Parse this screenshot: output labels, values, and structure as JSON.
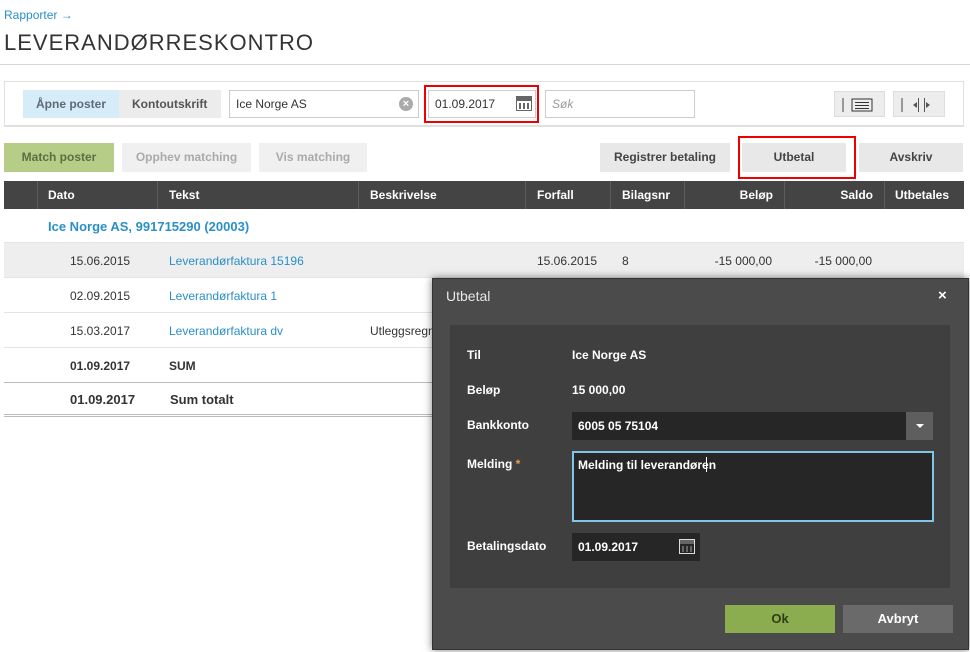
{
  "breadcrumb": "Rapporter →",
  "page_title": "LEVERANDØRRESKONTRO",
  "toolbar": {
    "tab_open": "Åpne poster",
    "tab_statement": "Kontoutskrift",
    "customer_value": "Ice Norge AS",
    "date_value": "01.09.2017",
    "search_placeholder": "Søk"
  },
  "actions": {
    "match": "Match poster",
    "unmatch": "Opphev matching",
    "show_match": "Vis matching",
    "register": "Registrer betaling",
    "pay": "Utbetal",
    "writeoff": "Avskriv"
  },
  "table": {
    "headers": [
      "Dato",
      "Tekst",
      "Beskrivelse",
      "Forfall",
      "Bilagsnr",
      "Beløp",
      "Saldo",
      "Utbetales"
    ],
    "group_title": "Ice Norge AS, 991715290 (20003)",
    "rows": [
      {
        "dato": "15.06.2015",
        "tekst": "Leverandørfaktura 15196",
        "beskrivelse": "",
        "forfall": "15.06.2015",
        "bilagsnr": "8",
        "belop": "-15 000,00",
        "saldo": "-15 000,00"
      },
      {
        "dato": "02.09.2015",
        "tekst": "Leverandørfaktura 1",
        "beskrivelse": "",
        "forfall": "",
        "bilagsnr": "",
        "belop": "",
        "saldo": ""
      },
      {
        "dato": "15.03.2017",
        "tekst": "Leverandørfaktura dv",
        "beskrivelse": "Utleggsregn",
        "forfall": "",
        "bilagsnr": "",
        "belop": "",
        "saldo": ""
      }
    ],
    "sum_row": {
      "dato": "01.09.2017",
      "tekst": "SUM"
    },
    "total_row": {
      "dato": "01.09.2017",
      "tekst": "Sum totalt"
    }
  },
  "dialog": {
    "title": "Utbetal",
    "close": "×",
    "to_label": "Til",
    "to_value": "Ice Norge AS",
    "amount_label": "Beløp",
    "amount_value": "15 000,00",
    "bank_label": "Bankkonto",
    "bank_value": "6005 05 75104",
    "message_label": "Melding",
    "required_mark": "*",
    "message_value": "Melding til leverandøren",
    "paydate_label": "Betalingsdato",
    "paydate_value": "01.09.2017",
    "ok": "Ok",
    "cancel": "Avbryt"
  },
  "colors": {
    "accent": "#2a8fc9",
    "highlight_red": "#ee0000",
    "ok_green": "#8cad4f",
    "header_dark": "#444444"
  }
}
